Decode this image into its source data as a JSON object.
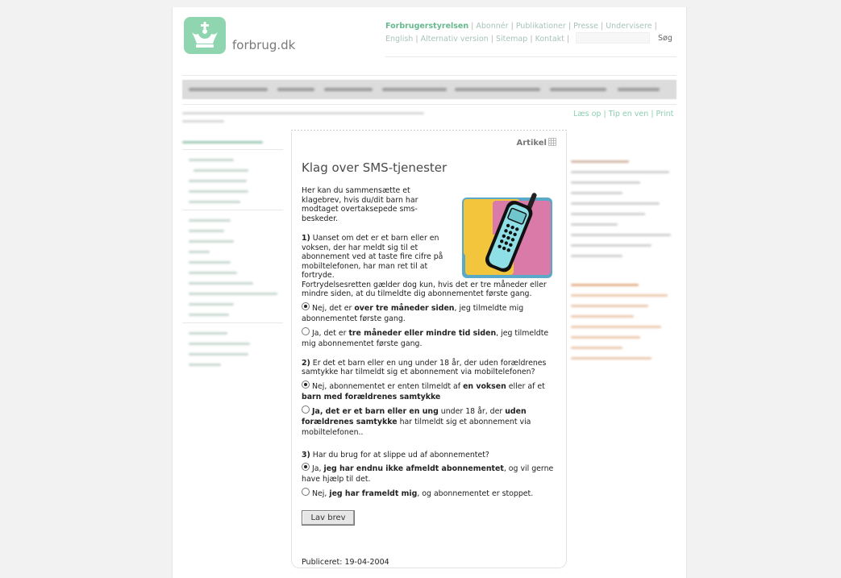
{
  "header": {
    "logo_text": "forbrug.dk",
    "top_links_row1": [
      "Forbrugerstyrelsen",
      "Abonnér",
      "Publikationer",
      "Presse",
      "Undervisere"
    ],
    "top_links_row2": [
      "English",
      "Alternativ version",
      "Sitemap",
      "Kontakt"
    ],
    "search_button": "Søg",
    "search_value": ""
  },
  "util_links": [
    "Læs op",
    "Tip en ven",
    "Print"
  ],
  "article": {
    "tab_label": "Artikel",
    "title": "Klag over SMS-tjenester",
    "intro": "Her kan du sammensætte et klagebrev, hvis du/dit barn har modtaget overtaksерede sms-beskeder.",
    "q1": {
      "num": "1)",
      "text_a": " Uanset om det er et barn eller en voksen, der har meldt sig til et abonnement ved at taste fire cifre på mobiltelefonen, har man ret til at fortryde.",
      "text_b": "Fortrydelsesretten gælder dog kun, hvis det er tre måneder eller mindre siden, at du tilmeldte dig abonnementet første gang.",
      "opt1_pre": "Nej, det er ",
      "opt1_bold": "over tre måneder siden",
      "opt1_post": ", jeg tilmeldte mig abonnementet første gang.",
      "opt2_pre": "Ja, det er ",
      "opt2_bold": "tre måneder eller mindre tid siden",
      "opt2_post": ", jeg tilmeldte mig abonnementet første gang."
    },
    "q2": {
      "num": "2)",
      "text": " Er det et barn eller en ung under 18 år, der uden forældrenes samtykke har tilmeldt sig et abonnement via mobiltelefonen?",
      "opt1_pre": "Nej, abonnementet er enten tilmeldt af ",
      "opt1_bold1": "en voksen",
      "opt1_mid": " eller af et ",
      "opt1_bold2": "barn med forældrenes samtykke",
      "opt2_bold1": "Ja, det er et barn eller en ung",
      "opt2_mid": " under 18 år, der ",
      "opt2_bold2": "uden forældrenes samtykke",
      "opt2_post": " har tilmeldt sig et abonnement via mobiltelefonen.."
    },
    "q3": {
      "num": "3)",
      "text": " Har du brug for at slippe ud af abonnementet?",
      "opt1_pre": "Ja, ",
      "opt1_bold": "jeg har endnu ikke afmeldt abonnementet",
      "opt1_post": ", og vil gerne have hjælp til det.",
      "opt2_pre": "Nej, ",
      "opt2_bold": "jeg har frameldt mig",
      "opt2_post": ", og abonnementet er stoppet."
    },
    "button": "Lav brev",
    "published": "Publiceret: 19-04-2004"
  }
}
